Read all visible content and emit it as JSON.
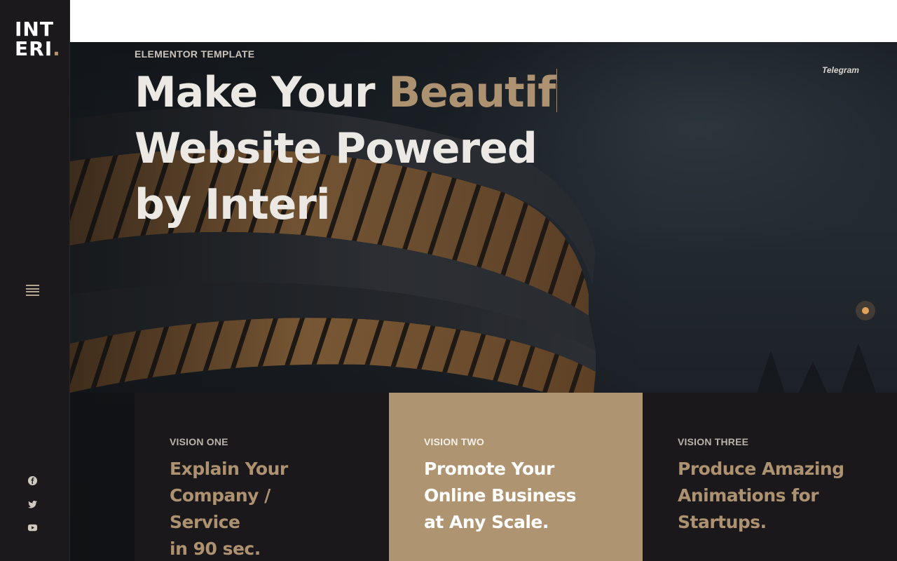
{
  "brand": {
    "logo_line1": "INT",
    "logo_line2_text": "ERI",
    "logo_line2_dot": ".",
    "accent_color": "#b09472"
  },
  "sidebar": {
    "menu_icon": "hamburger-icon",
    "social_icons": [
      "facebook-icon",
      "twitter-icon",
      "youtube-icon"
    ]
  },
  "hero": {
    "eyebrow": "ELEMENTOR TEMPLATE",
    "telegram_link": "Telegram",
    "headline_line1_plain": "Make Your ",
    "headline_line1_accent": "Beautif",
    "headline_line2": "Website Powered",
    "headline_line3": "by Interi",
    "text_color": "#ece9e4",
    "accent_color": "#ad9271"
  },
  "visions": [
    {
      "label": "VISION ONE",
      "title_lines": [
        "Explain Your",
        "Company /",
        "Service",
        "in 90 sec."
      ],
      "background": "#1b181b"
    },
    {
      "label": "VISION TWO",
      "title_lines": [
        "Promote Your",
        "Online Business",
        "at Any Scale."
      ],
      "background": "#af9472"
    },
    {
      "label": "VISION THREE",
      "title_lines": [
        "Produce Amazing",
        "Animations for",
        "Startups."
      ],
      "background": "#1b181b"
    }
  ]
}
